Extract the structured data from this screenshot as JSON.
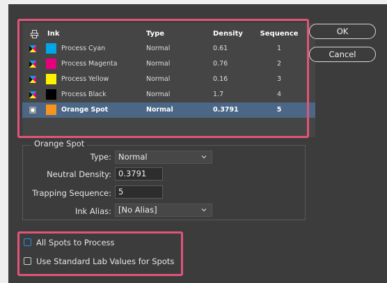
{
  "table": {
    "headers": {
      "ink": "Ink",
      "type": "Type",
      "density": "Density",
      "sequence": "Sequence"
    },
    "rows": [
      {
        "name": "Process Cyan",
        "type": "Normal",
        "density": "0.61",
        "sequence": "1",
        "color": "#00a6e8",
        "kind": "process"
      },
      {
        "name": "Process Magenta",
        "type": "Normal",
        "density": "0.76",
        "sequence": "2",
        "color": "#e6007e",
        "kind": "process"
      },
      {
        "name": "Process Yellow",
        "type": "Normal",
        "density": "0.16",
        "sequence": "3",
        "color": "#fff200",
        "kind": "process"
      },
      {
        "name": "Process Black",
        "type": "Normal",
        "density": "1.7",
        "sequence": "4",
        "color": "#000000",
        "kind": "process"
      },
      {
        "name": "Orange Spot",
        "type": "Normal",
        "density": "0.3791",
        "sequence": "5",
        "color": "#f7931e",
        "kind": "spot",
        "selected": true
      }
    ]
  },
  "buttons": {
    "ok": "OK",
    "cancel": "Cancel"
  },
  "group": {
    "title": "Orange Spot",
    "type_label": "Type:",
    "type_value": "Normal",
    "density_label": "Neutral Density:",
    "density_value": "0.3791",
    "sequence_label": "Trapping Sequence:",
    "sequence_value": "5",
    "alias_label": "Ink Alias:",
    "alias_value": "[No Alias]"
  },
  "options": {
    "all_spots": "All Spots to Process",
    "lab_values": "Use Standard Lab Values for Spots"
  },
  "colors": {
    "highlight": "#e2547a",
    "selected_row": "#4b6785",
    "focus": "#2d8ceb"
  }
}
